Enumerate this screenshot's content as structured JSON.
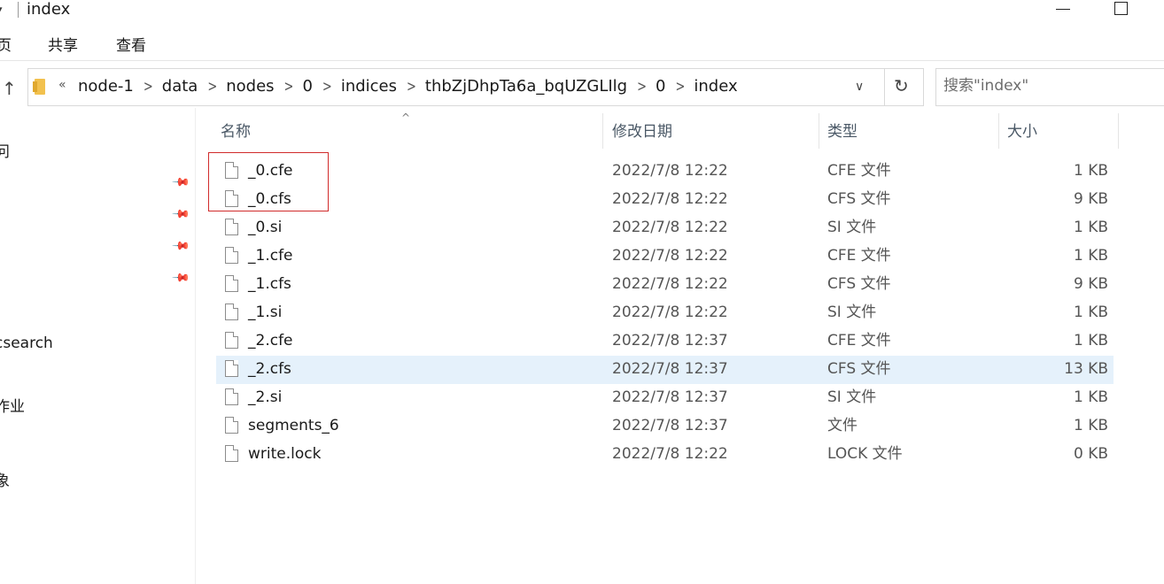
{
  "window": {
    "title": "index"
  },
  "ribbon": {
    "tabs": [
      "页",
      "共享",
      "查看"
    ]
  },
  "address": {
    "overflow": "«",
    "crumbs": [
      "node-1",
      "data",
      "nodes",
      "0",
      "indices",
      "thbZjDhpTa6a_bqUZGLIlg",
      "0",
      "index"
    ]
  },
  "search": {
    "placeholder": "搜索\"index\""
  },
  "nav": {
    "items": [
      "问",
      "csearch",
      "作业",
      "象"
    ]
  },
  "columns": {
    "name": "名称",
    "date": "修改日期",
    "type": "类型",
    "size": "大小"
  },
  "files": [
    {
      "name": "_0.cfe",
      "date": "2022/7/8 12:22",
      "type": "CFE 文件",
      "size": "1 KB"
    },
    {
      "name": "_0.cfs",
      "date": "2022/7/8 12:22",
      "type": "CFS 文件",
      "size": "9 KB"
    },
    {
      "name": "_0.si",
      "date": "2022/7/8 12:22",
      "type": "SI 文件",
      "size": "1 KB"
    },
    {
      "name": "_1.cfe",
      "date": "2022/7/8 12:22",
      "type": "CFE 文件",
      "size": "1 KB"
    },
    {
      "name": "_1.cfs",
      "date": "2022/7/8 12:22",
      "type": "CFS 文件",
      "size": "9 KB"
    },
    {
      "name": "_1.si",
      "date": "2022/7/8 12:22",
      "type": "SI 文件",
      "size": "1 KB"
    },
    {
      "name": "_2.cfe",
      "date": "2022/7/8 12:37",
      "type": "CFE 文件",
      "size": "1 KB"
    },
    {
      "name": "_2.cfs",
      "date": "2022/7/8 12:37",
      "type": "CFS 文件",
      "size": "13 KB"
    },
    {
      "name": "_2.si",
      "date": "2022/7/8 12:37",
      "type": "SI 文件",
      "size": "1 KB"
    },
    {
      "name": "segments_6",
      "date": "2022/7/8 12:37",
      "type": "文件",
      "size": "1 KB"
    },
    {
      "name": "write.lock",
      "date": "2022/7/8 12:22",
      "type": "LOCK 文件",
      "size": "0 KB"
    }
  ],
  "selected_file": "_2.cfs",
  "colors": {
    "selection": "#e5f1fb",
    "highlight_box": "#d12b2b",
    "folder": "#f2c14e"
  }
}
